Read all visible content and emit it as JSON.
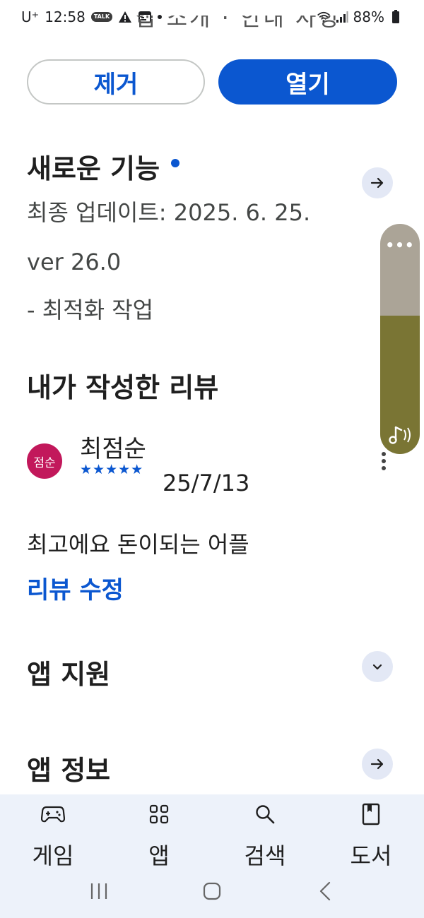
{
  "status_bar": {
    "carrier": "U⁺",
    "time": "12:58",
    "talk_badge": "TALK",
    "battery": "88%"
  },
  "clipped_heading": "앱 소개 · 안내 사항",
  "actions": {
    "remove_label": "제거",
    "open_label": "열기"
  },
  "whats_new": {
    "title": "새로운 기능",
    "last_updated": "최종 업데이트: 2025. 6. 25.",
    "version": "ver 26.0",
    "note": "- 최적화 작업"
  },
  "my_review": {
    "title": "내가 작성한 리뷰",
    "avatar_text": "점순",
    "reviewer": "최점순",
    "stars": "★★★★★",
    "date": "25/7/13",
    "body": "최고에요 돈이되는 어플",
    "edit_label": "리뷰 수정"
  },
  "app_support": {
    "title": "앱 지원"
  },
  "app_info": {
    "title": "앱 정보"
  },
  "overlay": {
    "dots": "•••",
    "level": 0.6
  },
  "bottom_nav": {
    "items": [
      {
        "label": "게임",
        "icon": "gamepad-icon"
      },
      {
        "label": "앱",
        "icon": "apps-grid-icon"
      },
      {
        "label": "검색",
        "icon": "search-icon"
      },
      {
        "label": "도서",
        "icon": "book-icon"
      }
    ]
  },
  "colors": {
    "accent": "#0b57d0",
    "avatar": "#c2185b",
    "nav_background": "#edf2fa",
    "overlay_top": "#aba497",
    "overlay_fill": "#7a7534"
  }
}
